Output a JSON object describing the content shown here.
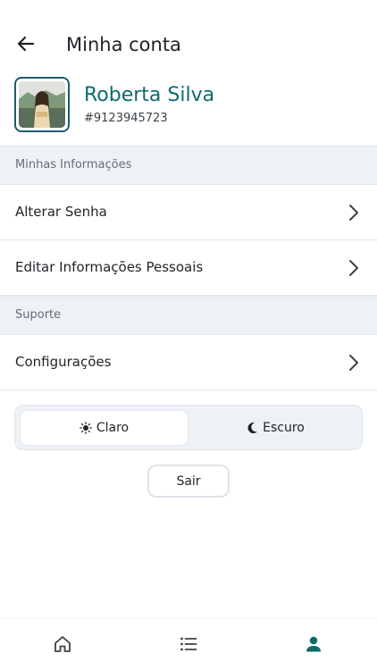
{
  "header": {
    "title": "Minha conta"
  },
  "profile": {
    "name": "Roberta Silva",
    "user_id": "#9123945723"
  },
  "sections": {
    "info": {
      "title": "Minhas Informações",
      "items": [
        {
          "label": "Alterar Senha"
        },
        {
          "label": "Editar Informações Pessoais"
        }
      ]
    },
    "support": {
      "title": "Suporte",
      "items": [
        {
          "label": "Configurações"
        }
      ]
    }
  },
  "theme": {
    "light_label": "Claro",
    "dark_label": "Escuro",
    "selected": "Claro"
  },
  "logout": {
    "label": "Sair"
  },
  "bottom_nav": {
    "items": [
      {
        "icon": "home-icon",
        "active": false
      },
      {
        "icon": "list-icon",
        "active": false
      },
      {
        "icon": "person-icon",
        "active": true
      }
    ]
  },
  "colors": {
    "accent": "#0d6b6b",
    "section_bg": "#eef2f7",
    "avatar_border": "#1d5c6c"
  }
}
